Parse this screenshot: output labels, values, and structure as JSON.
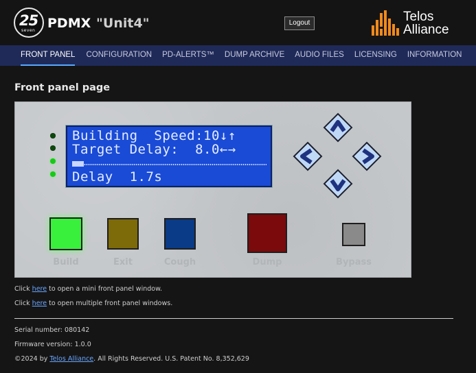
{
  "header": {
    "logo_number": "25",
    "logo_sub": "seven",
    "app_name": "PDMX",
    "unit_name": "\"Unit4\"",
    "logout_label": "Logout",
    "brand_line1": "Telos",
    "brand_line2": "Alliance"
  },
  "nav": {
    "items": [
      {
        "label": "FRONT PANEL",
        "active": true
      },
      {
        "label": "CONFIGURATION"
      },
      {
        "label": "PD-ALERTS™"
      },
      {
        "label": "DUMP ARCHIVE"
      },
      {
        "label": "AUDIO FILES"
      },
      {
        "label": "LICENSING"
      },
      {
        "label": "INFORMATION"
      }
    ]
  },
  "page_title": "Front panel page",
  "front_panel": {
    "leds": [
      "on",
      "on",
      "lit",
      "lit"
    ],
    "lcd": {
      "line1": "Building  Speed:10↓↑",
      "line2": "Target Delay:  8.0←→",
      "progress_fraction": 0.21,
      "line4": "Delay  1.7s"
    },
    "arrows": [
      "up",
      "left",
      "right",
      "down"
    ],
    "buttons": [
      {
        "label": "Build",
        "color": "#39f03c"
      },
      {
        "label": "Exit",
        "color": "#7d6a09"
      },
      {
        "label": "Cough",
        "color": "#0a3b86"
      },
      {
        "label": "Dump",
        "color": "#7a0a0c"
      },
      {
        "label": "Bypass",
        "color": "#8a8a8a"
      }
    ]
  },
  "links": {
    "mini_prefix": "Click ",
    "mini_link": "here",
    "mini_suffix": " to open a mini front panel window.",
    "multi_prefix": "Click ",
    "multi_link": "here",
    "multi_suffix": " to open multiple front panel windows."
  },
  "footer": {
    "serial": "Serial number: 080142",
    "firmware": "Firmware version: 1.0.0",
    "copyright_prefix": "©2024 by ",
    "copyright_link": "Telos Alliance",
    "copyright_suffix": ".  All Rights Reserved.  U.S. Patent No. 8,352,629"
  },
  "colors": {
    "nav_bg": "#1f2a58",
    "lcd_bg": "#1a4bd6",
    "link": "#6aa7ff",
    "telos_orange": "#f18a1c"
  }
}
